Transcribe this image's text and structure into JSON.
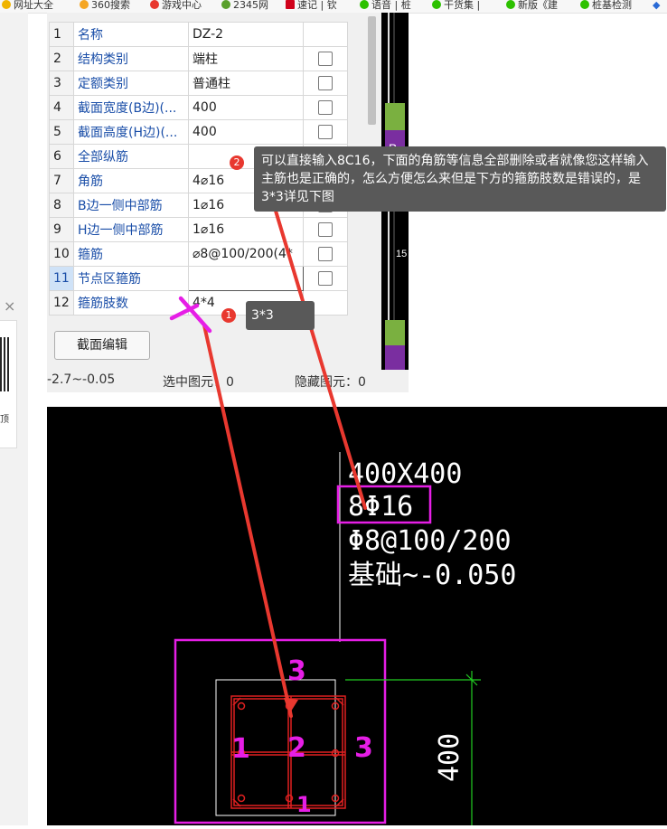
{
  "bookmarks": [
    {
      "label": "网址大全",
      "icon": "web-nav-icon",
      "color": "#f0b400"
    },
    {
      "label": "360搜索",
      "icon": "search-360-icon",
      "color": "#f5a623"
    },
    {
      "label": "游戏中心",
      "icon": "game-icon",
      "color": "#e8382f"
    },
    {
      "label": "2345网",
      "icon": "site-2345-icon",
      "color": "#5aa02c"
    },
    {
      "label": "速记 | 钦",
      "icon": "note-icon",
      "color": "#d0021b"
    },
    {
      "label": "语音 | 桩",
      "icon": "wechat-icon",
      "color": "#2dc100"
    },
    {
      "label": "干货集 |",
      "icon": "wechat-icon",
      "color": "#2dc100"
    },
    {
      "label": "新版《建",
      "icon": "wechat-icon",
      "color": "#2dc100"
    },
    {
      "label": "桩基检测",
      "icon": "wechat-icon",
      "color": "#2dc100"
    }
  ],
  "sidebar": {
    "close_symbol": "×",
    "fragment": "顶"
  },
  "properties": {
    "rows": [
      {
        "n": "1",
        "name": "名称",
        "value": "DZ-2",
        "check": false
      },
      {
        "n": "2",
        "name": "结构类别",
        "value": "端柱",
        "check": true
      },
      {
        "n": "3",
        "name": "定额类别",
        "value": "普通柱",
        "check": true
      },
      {
        "n": "4",
        "name": "截面宽度(B边)(...",
        "value": "400",
        "check": true
      },
      {
        "n": "5",
        "name": "截面高度(H边)(...",
        "value": "400",
        "check": true
      },
      {
        "n": "6",
        "name": "全部纵筋",
        "value": "",
        "check": true
      },
      {
        "n": "7",
        "name": "角筋",
        "value": "4⌀16",
        "check": true
      },
      {
        "n": "8",
        "name": "B边一侧中部筋",
        "value": "1⌀16",
        "check": true
      },
      {
        "n": "9",
        "name": "H边一侧中部筋",
        "value": "1⌀16",
        "check": true
      },
      {
        "n": "10",
        "name": "箍筋",
        "value": "⌀8@100/200(4*",
        "check": true
      },
      {
        "n": "11",
        "name": "节点区箍筋",
        "value": "",
        "check": true
      },
      {
        "n": "12",
        "name": "箍筋肢数",
        "value": "4*4",
        "check": false
      }
    ],
    "section_edit_button": "截面编辑",
    "status_range": "-2.7~-0.05",
    "status_selected": "选中图元：0",
    "status_hidden": "隐藏图元：0"
  },
  "annotations": {
    "tip1": {
      "number": "1",
      "text": "3*3"
    },
    "tip2": {
      "number": "2",
      "text": "可以直接输入8C16，下面的角筋等信息全部删除或者就像您这样输入主筋也是正确的，怎么方便怎么来但是下方的箍筋肢数是错误的，是3*3详见下图"
    }
  },
  "cad": {
    "section_size": "400X400",
    "main_rebar": "8Φ16",
    "stirrup": "Φ8@100/200",
    "elevation": "基础~-0.050",
    "dimension": "400",
    "marks": [
      "3",
      "1",
      "2",
      "3",
      "1"
    ]
  },
  "colors": {
    "magenta": "#e61ee6",
    "red_arrow": "#e8382f",
    "cad_red": "#e02020",
    "cad_green": "#22cc22",
    "link_blue": "#1a4ea8"
  }
}
